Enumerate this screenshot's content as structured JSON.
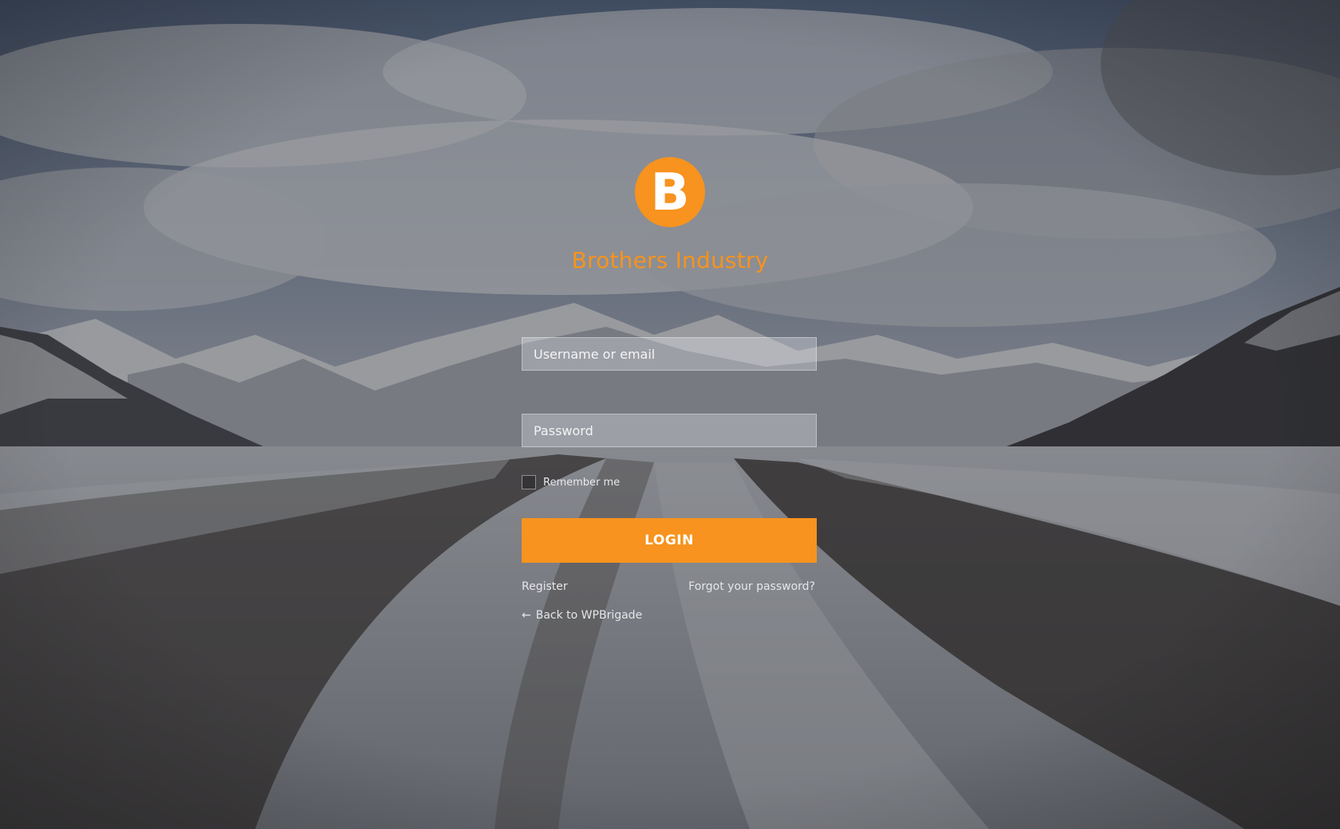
{
  "colors": {
    "accent": "#f7931e",
    "text_light": "#e8e8ec"
  },
  "logo": {
    "letter": "B"
  },
  "site": {
    "name": "Brothers Industry"
  },
  "form": {
    "username_placeholder": "Username or email",
    "password_placeholder": "Password",
    "remember_label": "Remember me",
    "login_label": "LOGIN"
  },
  "links": {
    "register": "Register",
    "forgot": "Forgot your password?",
    "back": "Back to WPBrigade",
    "back_icon": "left-arrow-icon"
  }
}
